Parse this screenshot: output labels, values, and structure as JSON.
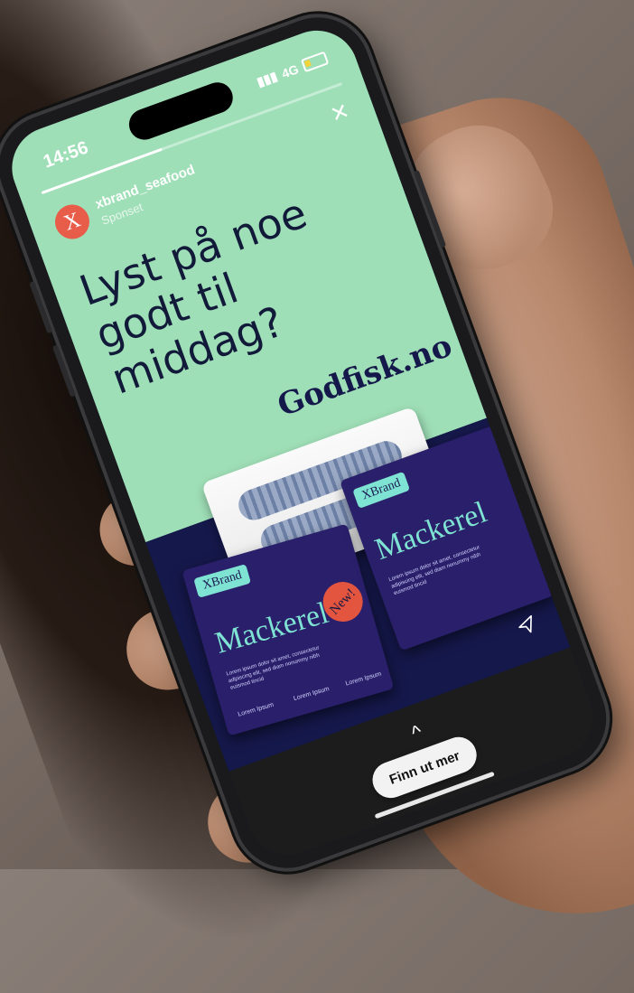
{
  "status_bar": {
    "time": "14:56",
    "network": "4G"
  },
  "story": {
    "progress_fraction": 0.4,
    "account_name": "xbrand_seafood",
    "sponsored_label": "Sponset",
    "avatar_letter": "X",
    "close_icon": "×"
  },
  "ad": {
    "headline": "Lyst på noe godt til middag?",
    "brand": "Godfisk.no",
    "pack_tag": "XBrand",
    "pack_title": "Mackerel",
    "pack_body": "Lorem ipsum dolor sit amet, consectetur adipiscing elit, sed diam nonummy nibh euismod tincid",
    "new_badge": "New!",
    "small_label_1": "Lorem Ipsum",
    "small_label_2": "Lorem Ipsum",
    "small_label_3": "Lorem Ipsum"
  },
  "footer": {
    "chevron_icon": "^",
    "cta_label": "Finn ut mer",
    "send_icon": "send-icon"
  },
  "colors": {
    "green_bg": "#9fdfb7",
    "navy_bg": "#15184a",
    "accent_red": "#e85d4a",
    "mint_text": "#7fe3d3"
  }
}
